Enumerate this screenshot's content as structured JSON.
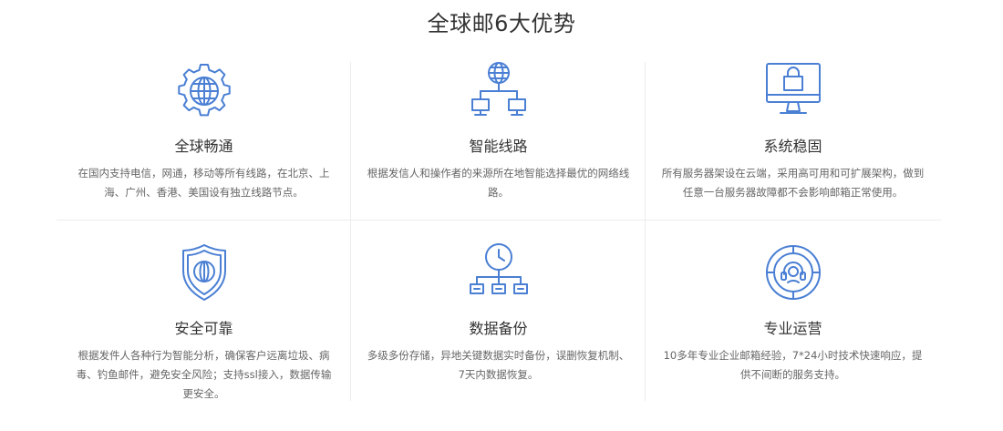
{
  "section": {
    "title": "全球邮6大优势"
  },
  "features": [
    {
      "title": "全球畅通",
      "desc": "在国内支持电信，网通，移动等所有线路，在北京、上海、广州、香港、美国设有独立线路节点。",
      "icon": "globe-gear-icon"
    },
    {
      "title": "智能线路",
      "desc": "根据发信人和操作者的来源所在地智能选择最优的网络线路。",
      "icon": "network-tree-icon"
    },
    {
      "title": "系统稳固",
      "desc": "所有服务器架设在云端，采用高可用和可扩展架构，做到任意一台服务器故障都不会影响邮箱正常使用。",
      "icon": "monitor-lock-icon"
    },
    {
      "title": "安全可靠",
      "desc": "根据发件人各种行为智能分析，确保客户远离垃圾、病毒、钓鱼邮件，避免安全风险；支持ssl接入，数据传输更安全。",
      "icon": "shield-globe-icon"
    },
    {
      "title": "数据备份",
      "desc": "多级多份存储，异地关键数据实时备份，误删恢复机制、7天内数据恢复。",
      "icon": "clock-backup-icon"
    },
    {
      "title": "专业运营",
      "desc": "10多年专业企业邮箱经验，7*24小时技术快速响应，提供不间断的服务支持。",
      "icon": "headset-target-icon"
    }
  ],
  "colors": {
    "accent": "#4a7fd4",
    "title": "#333333",
    "text": "#666666",
    "divider": "#ececec"
  }
}
